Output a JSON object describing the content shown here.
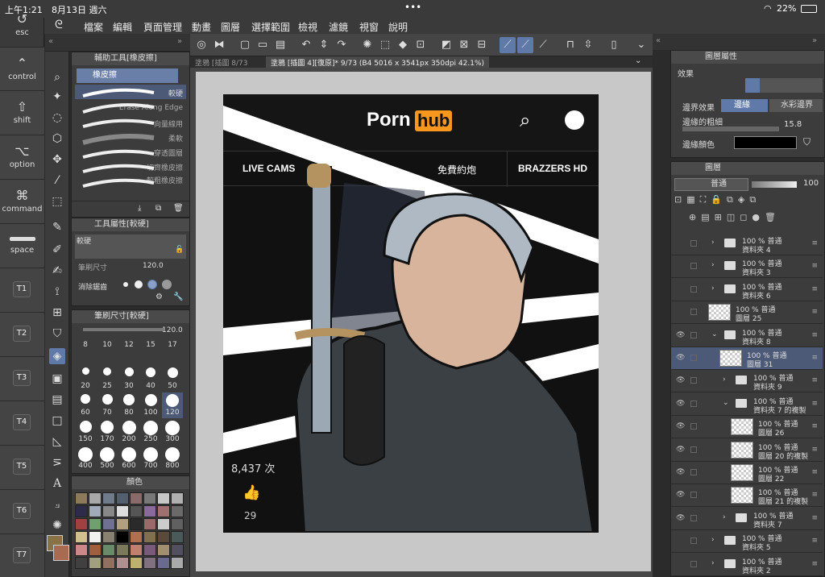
{
  "status": {
    "time": "上午1:21",
    "date": "8月13日 週六",
    "battery": "22%"
  },
  "menu": [
    "檔案",
    "編輯",
    "頁面管理",
    "動畫",
    "圖層",
    "選擇範圍",
    "檢視",
    "濾鏡",
    "視窗",
    "說明"
  ],
  "shortcuts": {
    "esc": "esc",
    "control": "control",
    "shift": "shift",
    "option": "option",
    "command": "command",
    "space": "space",
    "t": [
      "T1",
      "T2",
      "T3",
      "T4",
      "T5",
      "T6",
      "T7"
    ]
  },
  "subtool": {
    "title": "輔助工具[橡皮擦]",
    "group": "橡皮擦",
    "items": [
      "較硬",
      "Erase Along Edge",
      "向量線用",
      "柔軟",
      "穿透圖層",
      "切齊橡皮擦",
      "較粗橡皮擦"
    ]
  },
  "toolprop": {
    "title": "工具屬性[較硬]",
    "name": "較硬",
    "size_label": "筆刷尺寸",
    "size_value": "120.0",
    "aa_label": "消除鋸齒"
  },
  "brushsize": {
    "title": "筆刷尺寸[較硬]",
    "value": "120.0",
    "sizes": [
      "8",
      "10",
      "12",
      "15",
      "17",
      "20",
      "25",
      "30",
      "40",
      "50",
      "60",
      "70",
      "80",
      "100",
      "120",
      "150",
      "170",
      "200",
      "250",
      "300",
      "400",
      "500",
      "600",
      "700",
      "800"
    ]
  },
  "color": {
    "title": "顏色"
  },
  "tabs": {
    "tab1": "塗鴉 [插圖 8/73",
    "tab2": "塗鴉 [插圖 4][復原]* 9/73 (B4 5016 x 3541px 350dpi 42.1%)"
  },
  "art": {
    "logo_a": "Porn",
    "logo_b": "hub",
    "nav": [
      "LIVE CAMS",
      "免費約炮",
      "BRAZZERS HD"
    ],
    "views": "8,437 次",
    "likes": "29"
  },
  "layerprop": {
    "title": "圖層屬性",
    "effect": "效果",
    "border_effect": "邊界效果",
    "opt_border": "邊緣",
    "opt_water": "水彩邊界",
    "thickness_label": "邊緣的粗細",
    "thickness": "15.8",
    "color_label": "邊緣顏色"
  },
  "layers": {
    "title": "圖層",
    "blend": "普通",
    "opacity": "100",
    "items": [
      {
        "pct": "100 % 普通",
        "name": "資料夾 4",
        "kind": "folder",
        "indent": 0
      },
      {
        "pct": "100 % 普通",
        "name": "資料夾 3",
        "kind": "folder",
        "indent": 0
      },
      {
        "pct": "100 % 普通",
        "name": "資料夾 6",
        "kind": "folder",
        "indent": 0
      },
      {
        "pct": "100 % 普通",
        "name": "圖層 25",
        "kind": "layer",
        "indent": 0
      },
      {
        "pct": "100 % 普通",
        "name": "資料夾 8",
        "kind": "folder",
        "indent": 0
      },
      {
        "pct": "100 % 普通",
        "name": "圖層 31",
        "kind": "layer",
        "indent": 1
      },
      {
        "pct": "100 % 普通",
        "name": "資料夾 9",
        "kind": "folder",
        "indent": 1
      },
      {
        "pct": "100 % 普通",
        "name": "資料夾 7 的複製",
        "kind": "folder",
        "indent": 1
      },
      {
        "pct": "100 % 普通",
        "name": "圖層 26",
        "kind": "layer",
        "indent": 2
      },
      {
        "pct": "100 % 普通",
        "name": "圖層 20 的複製",
        "kind": "layer",
        "indent": 2
      },
      {
        "pct": "100 % 普通",
        "name": "圖層 22",
        "kind": "layer",
        "indent": 2
      },
      {
        "pct": "100 % 普通",
        "name": "圖層 21 的複製",
        "kind": "layer",
        "indent": 2
      },
      {
        "pct": "100 % 普通",
        "name": "資料夾 7",
        "kind": "folder",
        "indent": 1
      },
      {
        "pct": "100 % 普通",
        "name": "資料夾 5",
        "kind": "folder",
        "indent": 0
      },
      {
        "pct": "100 % 普通",
        "name": "資料夾 2",
        "kind": "folder",
        "indent": 0
      }
    ]
  }
}
